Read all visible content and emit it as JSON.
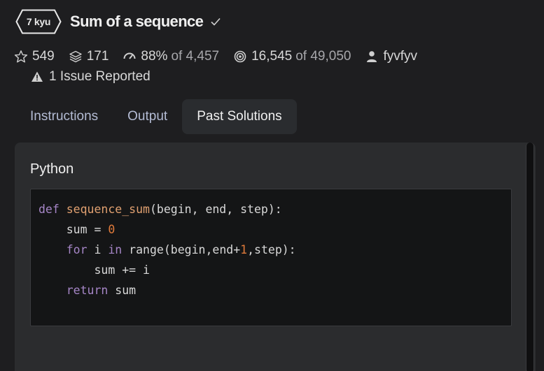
{
  "kata": {
    "rank": "7 kyu",
    "title": "Sum of a sequence"
  },
  "stats": {
    "stars": "549",
    "collections": "171",
    "satisfaction": "88%",
    "satisfaction_of": "of 4,457",
    "completed": "16,545",
    "completed_of": "of 49,050",
    "author": "fyvfyv"
  },
  "issues": "1 Issue Reported",
  "tabs": [
    {
      "label": "Instructions"
    },
    {
      "label": "Output"
    },
    {
      "label": "Past Solutions"
    }
  ],
  "solution": {
    "language": "Python",
    "code_lines": [
      [
        {
          "t": "kw",
          "v": "def "
        },
        {
          "t": "fn",
          "v": "sequence_sum"
        },
        {
          "t": "pl",
          "v": "(begin, end, step):"
        }
      ],
      [
        {
          "t": "pl",
          "v": "    sum = "
        },
        {
          "t": "num",
          "v": "0"
        }
      ],
      [
        {
          "t": "pl",
          "v": "    "
        },
        {
          "t": "kw",
          "v": "for"
        },
        {
          "t": "pl",
          "v": " i "
        },
        {
          "t": "kw",
          "v": "in"
        },
        {
          "t": "pl",
          "v": " range(begin,end+"
        },
        {
          "t": "num",
          "v": "1"
        },
        {
          "t": "pl",
          "v": ",step):"
        }
      ],
      [
        {
          "t": "pl",
          "v": "        sum += i"
        }
      ],
      [
        {
          "t": "pl",
          "v": "    "
        },
        {
          "t": "kw",
          "v": "return"
        },
        {
          "t": "pl",
          "v": " sum"
        }
      ]
    ]
  },
  "icons": {
    "rank_badge": "hexagon-badge",
    "verified": "check-icon",
    "stars": "star-icon",
    "collections": "layers-icon",
    "satisfaction": "gauge-icon",
    "completed": "target-icon",
    "author": "user-icon",
    "issue": "warning-icon"
  }
}
